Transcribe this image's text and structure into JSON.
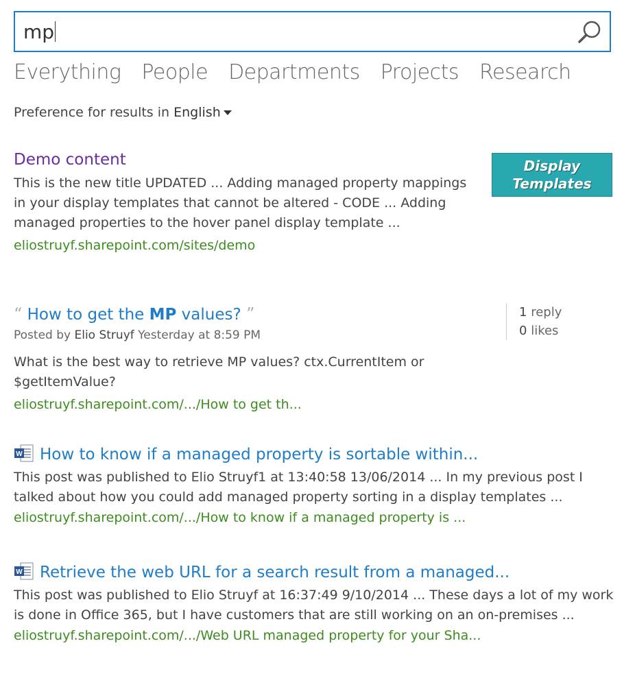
{
  "search": {
    "query": "mp"
  },
  "verticals": [
    "Everything",
    "People",
    "Departments",
    "Projects",
    "Research"
  ],
  "preference": {
    "label": "Preference for results in",
    "language": "English"
  },
  "results": [
    {
      "title": "Demo content",
      "description": "This is the new title UPDATED ... Adding managed property mappings in your display templates that cannot be altered - CODE ... Adding managed properties to the hover panel display template ...",
      "url": "eliostruyf.sharepoint.com/sites/demo",
      "thumbnail": {
        "line1": "Display",
        "line2": "Templates"
      }
    },
    {
      "title_prefix": "How to get the ",
      "title_bold": "MP",
      "title_suffix": " values?",
      "posted_by_label": "Posted by",
      "author": "Elio Struyf",
      "time": "Yesterday at 8:59 PM",
      "replies_count": "1",
      "replies_label": "reply",
      "likes_count": "0",
      "likes_label": "likes",
      "description": "What is the best way to retrieve MP values? ctx.CurrentItem or $getItemValue?",
      "url": "eliostruyf.sharepoint.com/.../How to get th..."
    },
    {
      "title": "How to know if a managed property is sortable within...",
      "description": "This post was published to Elio Struyf1 at 13:40:58 13/06/2014 ... In my previous post I talked about how you could add managed property sorting in a display templates ...",
      "url": "eliostruyf.sharepoint.com/.../How to know if a managed property is ..."
    },
    {
      "title": "Retrieve the web URL for a search result from a managed...",
      "description": "This post was published to Elio Struyf at 16:37:49 9/10/2014 ... These days a lot of my work is done in Office 365, but I have customers that are still working on an on-premises ...",
      "url": "eliostruyf.sharepoint.com/.../Web URL managed property for your Sha..."
    }
  ],
  "colors": {
    "accent": "#1f7dc8",
    "visited": "#6b2d9c",
    "url": "#3c8c1e",
    "thumbnail": "#2aa8b0"
  }
}
